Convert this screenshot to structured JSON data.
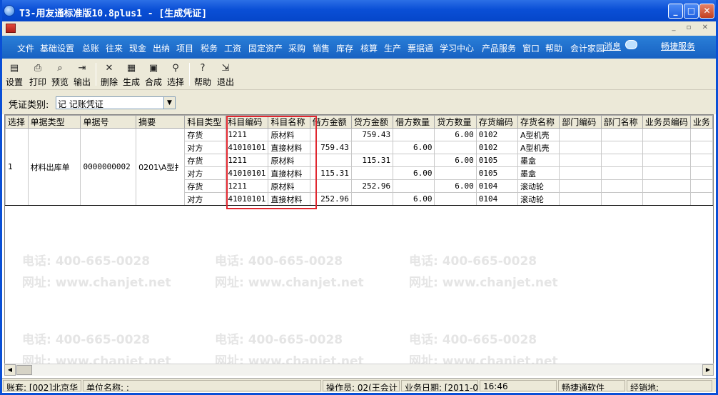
{
  "window": {
    "title": "T3-用友通标准版10.8plus1 - [生成凭证]"
  },
  "menubar": {
    "items": [
      "文件",
      "基础设置",
      "总账",
      "往来",
      "现金",
      "出纳",
      "项目",
      "税务",
      "工资",
      "固定资产",
      "采购",
      "销售",
      "库存",
      "核算",
      "生产",
      "票据通",
      "学习中心",
      "产品服务",
      "窗口",
      "帮助",
      "会计家园"
    ],
    "message_label": "消息",
    "link_label": "畅捷服务"
  },
  "toolbar": {
    "buttons": [
      {
        "label": "设置",
        "icon": "settings-icon"
      },
      {
        "label": "打印",
        "icon": "print-icon"
      },
      {
        "label": "预览",
        "icon": "preview-icon"
      },
      {
        "label": "输出",
        "icon": "export-icon"
      },
      {
        "label": "删除",
        "icon": "delete-icon"
      },
      {
        "label": "生成",
        "icon": "generate-icon"
      },
      {
        "label": "合成",
        "icon": "merge-icon"
      },
      {
        "label": "选择",
        "icon": "select-icon"
      },
      {
        "label": "帮助",
        "icon": "help-icon"
      },
      {
        "label": "退出",
        "icon": "exit-icon"
      }
    ]
  },
  "voucher_type": {
    "label": "凭证类别:",
    "value": "记 记账凭证"
  },
  "grid": {
    "columns": [
      "选择",
      "单据类型",
      "单据号",
      "摘要",
      "科目类型",
      "科目编码",
      "科目名称",
      "借方金额",
      "贷方金额",
      "借方数量",
      "贷方数量",
      "存货编码",
      "存货名称",
      "部门编码",
      "部门名称",
      "业务员编码",
      "业务"
    ],
    "group": {
      "select": "1",
      "doc_type": "材料出库单",
      "doc_no": "0000000002",
      "summary": "0201\\A型扌"
    },
    "rows": [
      {
        "subject_type": "存货",
        "subject_code": "1211",
        "subject_name": "原材料",
        "debit": "",
        "credit": "759.43",
        "debit_qty": "",
        "credit_qty": "6.00",
        "inv_code": "0102",
        "inv_name": "A型机壳"
      },
      {
        "subject_type": "对方",
        "subject_code": "41010101",
        "subject_name": "直接材料",
        "debit": "759.43",
        "credit": "",
        "debit_qty": "6.00",
        "credit_qty": "",
        "inv_code": "0102",
        "inv_name": "A型机壳"
      },
      {
        "subject_type": "存货",
        "subject_code": "1211",
        "subject_name": "原材料",
        "debit": "",
        "credit": "115.31",
        "debit_qty": "",
        "credit_qty": "6.00",
        "inv_code": "0105",
        "inv_name": "墨盒"
      },
      {
        "subject_type": "对方",
        "subject_code": "41010101",
        "subject_name": "直接材料",
        "debit": "115.31",
        "credit": "",
        "debit_qty": "6.00",
        "credit_qty": "",
        "inv_code": "0105",
        "inv_name": "墨盒"
      },
      {
        "subject_type": "存货",
        "subject_code": "1211",
        "subject_name": "原材料",
        "debit": "",
        "credit": "252.96",
        "debit_qty": "",
        "credit_qty": "6.00",
        "inv_code": "0104",
        "inv_name": "滚动轮"
      },
      {
        "subject_type": "对方",
        "subject_code": "41010101",
        "subject_name": "直接材料",
        "debit": "252.96",
        "credit": "",
        "debit_qty": "6.00",
        "credit_qty": "",
        "inv_code": "0104",
        "inv_name": "滚动轮"
      }
    ]
  },
  "watermark": {
    "phone": "电话: 400-665-0028",
    "site": "网址: www.chanjet.net"
  },
  "statusbar": {
    "account": "账套: [002]北京华",
    "unit": "单位名称: :",
    "operator": "操作员: 02(王会计",
    "business_date": "业务日期: [2011-0",
    "time": "16:46",
    "vendor": "畅捷通软件",
    "location": "经销地:"
  },
  "colors": {
    "titlebar": "#0a4fd6",
    "menubar": "#1f6fce",
    "highlight_box": "#e0262e",
    "watermark": "#e5e5e5"
  }
}
